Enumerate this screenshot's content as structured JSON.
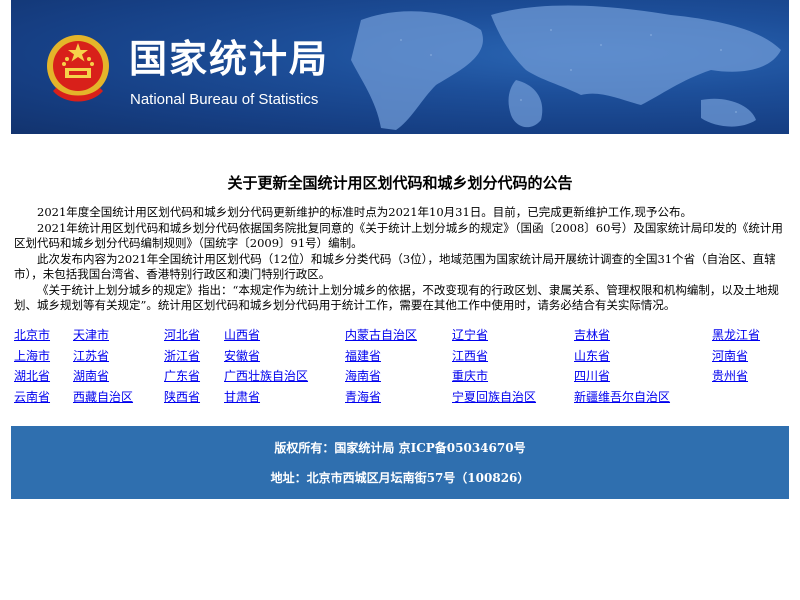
{
  "header": {
    "logo_cn": "国家统计局",
    "logo_en": "National Bureau of Statistics",
    "bg_color": "#1d4f9a"
  },
  "article": {
    "title": "关于更新全国统计用区划代码和城乡划分代码的公告",
    "paragraphs": [
      "2021年度全国统计用区划代码和城乡划分代码更新维护的标准时点为2021年10月31日。目前，已完成更新维护工作,现予公布。",
      "2021年统计用区划代码和城乡划分代码依据国务院批复同意的《关于统计上划分城乡的规定》（国函〔2008〕60号）及国家统计局印发的《统计用区划代码和城乡划分代码编制规则》（国统字〔2009〕91号）编制。",
      "此次发布内容为2021年全国统计用区划代码（12位）和城乡分类代码（3位），地域范围为国家统计局开展统计调查的全国31个省（自治区、直辖市），未包括我国台湾省、香港特别行政区和澳门特别行政区。",
      "《关于统计上划分城乡的规定》指出：“本规定作为统计上划分城乡的依据，不改变现有的行政区划、隶属关系、管理权限和机构编制，以及土地规划、城乡规划等有关规定”。统计用区划代码和城乡划分代码用于统计工作，需要在其他工作中使用时，请务必结合有关实际情况。"
    ]
  },
  "provinces": [
    [
      "北京市",
      "天津市",
      "河北省",
      "山西省",
      "内蒙古自治区",
      "辽宁省",
      "吉林省",
      "黑龙江省"
    ],
    [
      "上海市",
      "江苏省",
      "浙江省",
      "安徽省",
      "福建省",
      "江西省",
      "山东省",
      "河南省"
    ],
    [
      "湖北省",
      "湖南省",
      "广东省",
      "广西壮族自治区",
      "海南省",
      "重庆市",
      "四川省",
      "贵州省"
    ],
    [
      "云南省",
      "西藏自治区",
      "陕西省",
      "甘肃省",
      "青海省",
      "宁夏回族自治区",
      "新疆维吾尔自治区"
    ]
  ],
  "footer": {
    "copyright": "版权所有：国家统计局 京ICP备05034670号",
    "address": "地址：北京市西城区月坛南街57号（100826）",
    "bg_color": "#2f6faf"
  }
}
